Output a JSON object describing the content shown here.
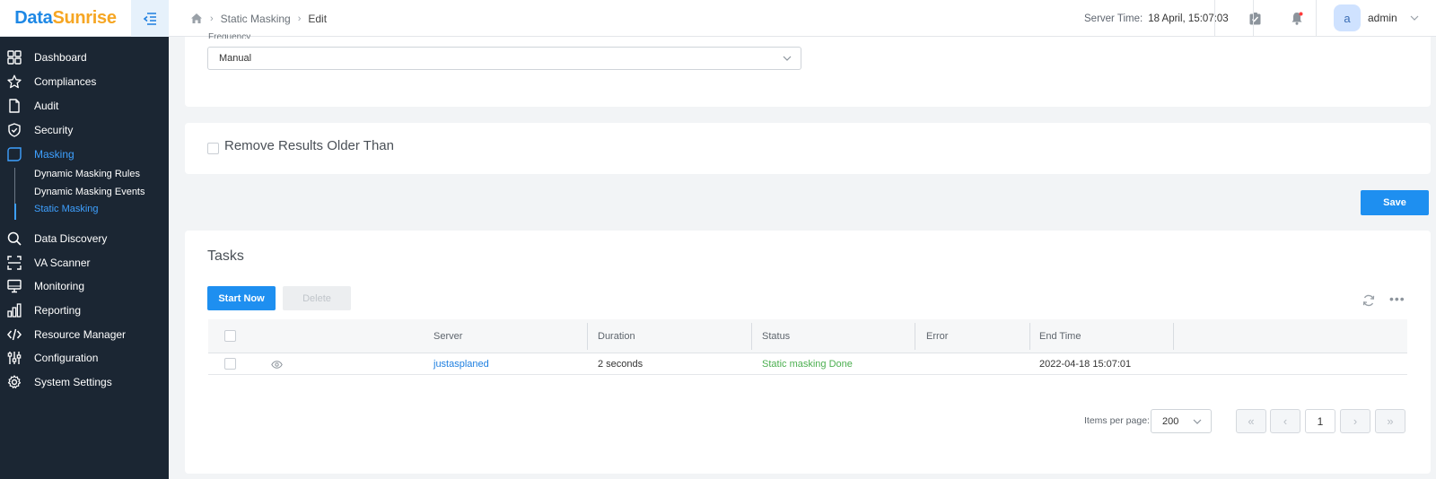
{
  "logo": {
    "part1": "Data",
    "part2": "Sunrise"
  },
  "breadcrumb": {
    "items": [
      "Static Masking",
      "Edit"
    ]
  },
  "header": {
    "server_time_label": "Server Time:",
    "server_time_value": "18 April, 15:07:03",
    "user_initial": "a",
    "user_name": "admin"
  },
  "sidebar": {
    "items": [
      {
        "label": "Dashboard",
        "icon": "grid-icon"
      },
      {
        "label": "Compliances",
        "icon": "star-icon"
      },
      {
        "label": "Audit",
        "icon": "document-icon"
      },
      {
        "label": "Security",
        "icon": "shield-icon"
      },
      {
        "label": "Masking",
        "icon": "mask-icon",
        "active": true
      },
      {
        "label": "Data Discovery",
        "icon": "search-icon"
      },
      {
        "label": "VA Scanner",
        "icon": "scan-icon"
      },
      {
        "label": "Monitoring",
        "icon": "monitor-icon"
      },
      {
        "label": "Reporting",
        "icon": "bar-chart-icon"
      },
      {
        "label": "Resource Manager",
        "icon": "code-icon"
      },
      {
        "label": "Configuration",
        "icon": "sliders-icon"
      },
      {
        "label": "System Settings",
        "icon": "gear-icon"
      }
    ],
    "subitems": [
      {
        "label": "Dynamic Masking Rules"
      },
      {
        "label": "Dynamic Masking Events"
      },
      {
        "label": "Static Masking",
        "active": true
      }
    ]
  },
  "frequency": {
    "label": "Frequency",
    "value": "Manual"
  },
  "remove_results": {
    "label": "Remove Results Older Than"
  },
  "save_label": "Save",
  "tasks": {
    "title": "Tasks",
    "start_label": "Start Now",
    "delete_label": "Delete",
    "columns": [
      "Server",
      "Duration",
      "Status",
      "Error",
      "End Time"
    ],
    "rows": [
      {
        "server": "justasplaned",
        "duration": "2 seconds",
        "status": "Static masking Done",
        "error": "",
        "end_time": "2022-04-18 15:07:01"
      }
    ]
  },
  "pagination": {
    "items_per_page_label": "Items per page:",
    "items_per_page": "200",
    "current_page": "1"
  },
  "colors": {
    "accent": "#1e8ff0",
    "sidebar_bg": "#1b2633",
    "active_nav": "#3ea0ff",
    "status_ok": "#4caf50"
  }
}
